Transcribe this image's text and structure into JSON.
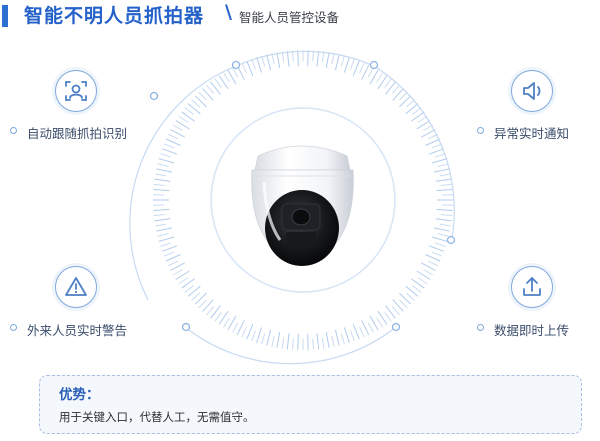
{
  "header": {
    "title": "智能不明人员抓拍器",
    "slash": "\\",
    "subtitle": "智能人员管控设备"
  },
  "features": {
    "auto_capture": {
      "label": "自动跟随抓拍识别",
      "icon": "person-scan-icon"
    },
    "alert": {
      "label": "异常实时通知",
      "icon": "speaker-icon"
    },
    "stranger": {
      "label": "外来人员实时警告",
      "icon": "warning-triangle-icon"
    },
    "upload": {
      "label": "数据即时上传",
      "icon": "upload-icon"
    }
  },
  "panel": {
    "title": "优势：",
    "text": "用于关键入口，代替人工，无需值守。"
  },
  "colors": {
    "accent": "#2461c8",
    "ring": "#8fb4e3",
    "icon_stroke": "#4f7fc4",
    "panel_bg": "#f4f7fc"
  }
}
